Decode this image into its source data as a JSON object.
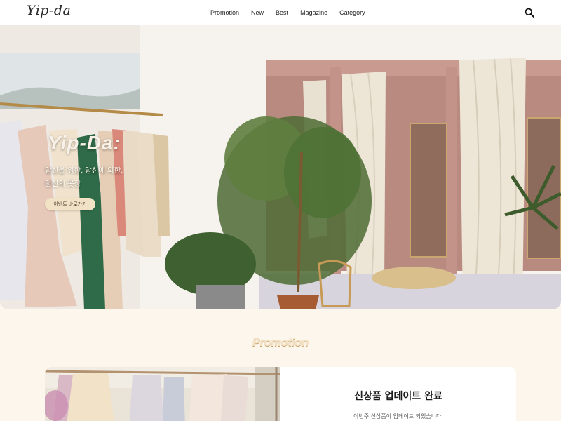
{
  "header": {
    "logo": "Yip-da",
    "nav": [
      "Promotion",
      "New",
      "Best",
      "Magazine",
      "Category"
    ],
    "search_icon": "search-icon"
  },
  "hero": {
    "title": "Yip-Da:",
    "subtitle_line1": "당신을 위한, 당신에 의한,",
    "subtitle_line2": "당신의 옷장",
    "button_label": "이벤트 바로가기",
    "accent_color": "#f1e2c5"
  },
  "promotion": {
    "section_title": "Promotion",
    "card_title": "신상품 업데이트 완료",
    "card_desc": "이번주 신상품이 업데이트 되었습니다."
  }
}
